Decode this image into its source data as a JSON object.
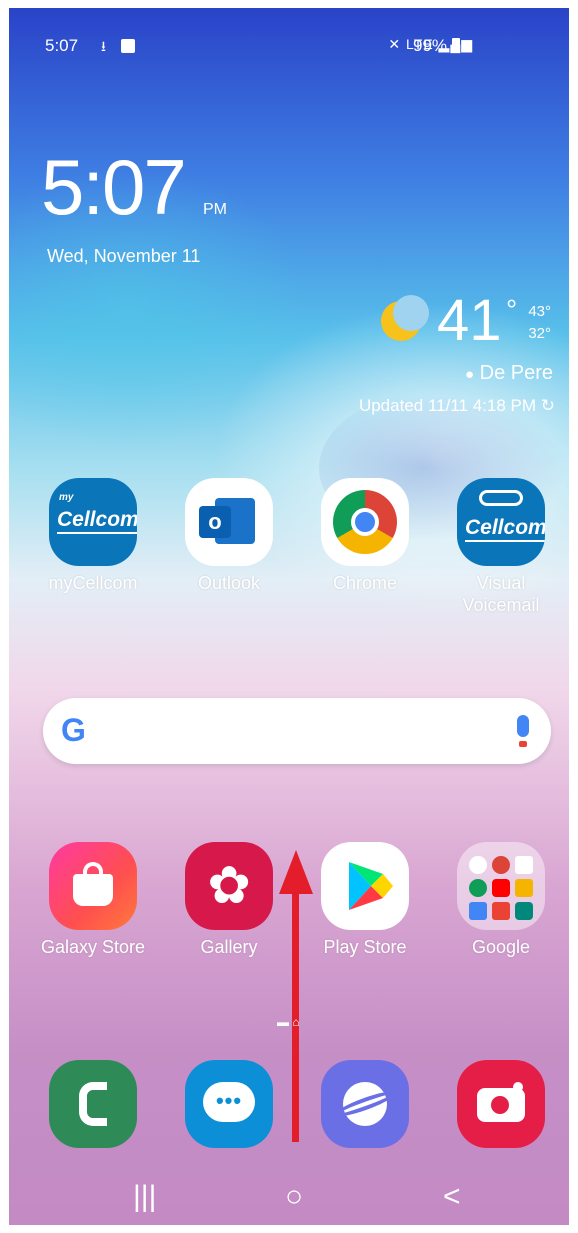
{
  "status_bar": {
    "time": "5:07",
    "signal": "LTE",
    "battery": "99%"
  },
  "clock": {
    "time": "5:07",
    "ampm": "PM",
    "date": "Wed, November 11"
  },
  "weather": {
    "temp": "41",
    "degree": "°",
    "high": "43°",
    "low": "32°",
    "location": "De Pere",
    "updated": "Updated 11/11 4:18 PM"
  },
  "apps_row1": [
    {
      "label": "myCellcom"
    },
    {
      "label": "Outlook"
    },
    {
      "label": "Chrome"
    },
    {
      "label": "Visual Voicemail"
    }
  ],
  "apps_row2": [
    {
      "label": "Galaxy Store"
    },
    {
      "label": "Gallery"
    },
    {
      "label": "Play Store"
    },
    {
      "label": "Google"
    }
  ],
  "search": {
    "logo": "G"
  },
  "brand": {
    "cellcom": "Cellcom",
    "my": "my"
  },
  "outlook_letter": "o",
  "dock": [
    {
      "name": "phone-icon"
    },
    {
      "name": "messages-icon"
    },
    {
      "name": "internet-icon"
    },
    {
      "name": "camera-icon"
    }
  ],
  "nav": {
    "recent": "|||",
    "home": "○",
    "back": "<"
  },
  "colors": {
    "arrow": "#e31d2a",
    "google_blue": "#4285f4"
  }
}
